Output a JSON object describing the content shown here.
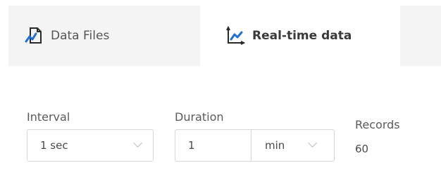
{
  "tabs": [
    {
      "label": "Data Files",
      "icon": "data-file-icon",
      "active": false
    },
    {
      "label": "Real-time data",
      "icon": "line-chart-icon",
      "active": true
    }
  ],
  "form": {
    "interval": {
      "label": "Interval",
      "value": "1 sec"
    },
    "duration": {
      "label": "Duration",
      "value": "1",
      "unit": "min"
    },
    "records": {
      "label": "Records",
      "value": "60"
    }
  },
  "colors": {
    "accent": "#1e6fd6",
    "tab_bg": "#f4f4f4",
    "border": "#d6d6d6"
  }
}
